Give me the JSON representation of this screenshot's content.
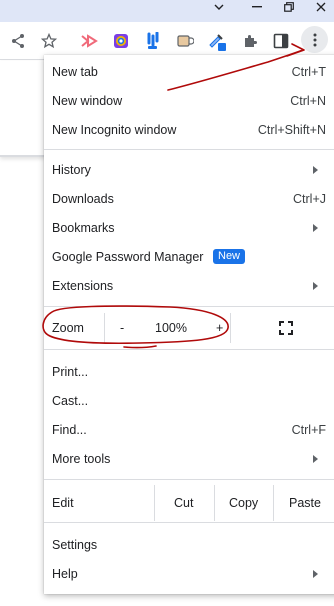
{
  "window": {
    "minimize_icon": "chevron-down",
    "restore_icon": "restore",
    "close_icon": "close"
  },
  "toolbar": {
    "icons": [
      "share-icon",
      "star-icon",
      "extension-arrow-icon",
      "extension-colorful-icon",
      "extension-blue-icon",
      "extension-cup-icon",
      "extension-eyedropper-icon",
      "puzzle-icon",
      "side-panel-icon",
      "more-menu-icon"
    ]
  },
  "menu": {
    "new_tab": {
      "label": "New tab",
      "shortcut": "Ctrl+T"
    },
    "new_window": {
      "label": "New window",
      "shortcut": "Ctrl+N"
    },
    "new_incognito": {
      "label": "New Incognito window",
      "shortcut": "Ctrl+Shift+N"
    },
    "history": {
      "label": "History"
    },
    "downloads": {
      "label": "Downloads",
      "shortcut": "Ctrl+J"
    },
    "bookmarks": {
      "label": "Bookmarks"
    },
    "password_manager": {
      "label": "Google Password Manager",
      "badge": "New"
    },
    "extensions": {
      "label": "Extensions"
    },
    "zoom": {
      "label": "Zoom",
      "minus": "-",
      "value": "100%",
      "plus": "+"
    },
    "print": {
      "label": "Print..."
    },
    "cast": {
      "label": "Cast..."
    },
    "find": {
      "label": "Find...",
      "shortcut": "Ctrl+F"
    },
    "more_tools": {
      "label": "More tools"
    },
    "edit": {
      "label": "Edit",
      "cut": "Cut",
      "copy": "Copy",
      "paste": "Paste"
    },
    "settings": {
      "label": "Settings"
    },
    "help": {
      "label": "Help"
    }
  },
  "colors": {
    "accent": "#1a73e8",
    "annotation": "#b00a0a",
    "titlebar": "#dfe6f7"
  }
}
